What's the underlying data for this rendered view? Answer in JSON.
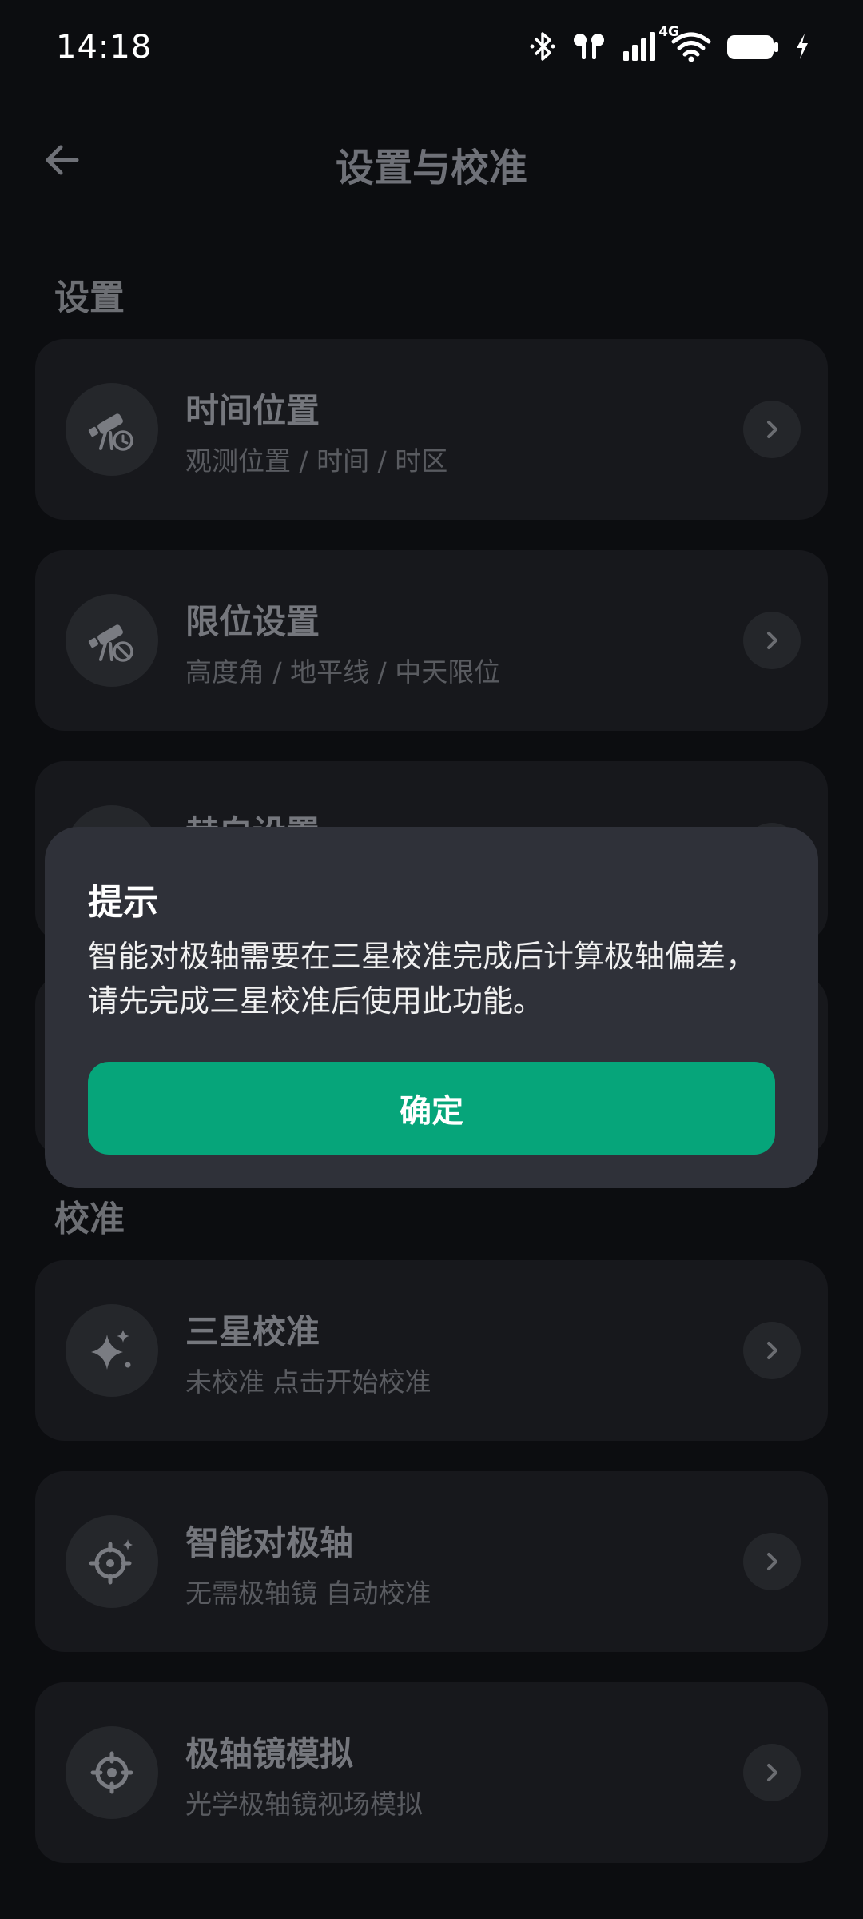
{
  "status_bar": {
    "time": "14:18",
    "network": "4G",
    "icons": [
      "bluetooth-icon",
      "earbuds-icon",
      "signal-icon",
      "wifi-icon",
      "battery-icon",
      "charging-icon"
    ]
  },
  "header": {
    "back_icon": "arrow-left-icon",
    "title": "设置与校准"
  },
  "sections": {
    "settings": "设置",
    "calibration": "校准"
  },
  "settings_items": [
    {
      "title": "时间位置",
      "subtitle": "观测位置 / 时间 / 时区",
      "icon": "telescope-clock-icon"
    },
    {
      "title": "限位设置",
      "subtitle": "高度角 / 地平线 / 中天限位",
      "icon": "telescope-block-icon"
    },
    {
      "title": "赫白设置",
      "subtitle": "",
      "icon": "telescope-icon"
    }
  ],
  "calibration_items": [
    {
      "title": "三星校准",
      "subtitle": "未校准 点击开始校准",
      "icon": "sparkle-stars-icon"
    },
    {
      "title": "智能对极轴",
      "subtitle": "无需极轴镜 自动校准",
      "icon": "target-sparkle-icon"
    },
    {
      "title": "极轴镜模拟",
      "subtitle": "光学极轴镜视场模拟",
      "icon": "crosshair-icon"
    }
  ],
  "dialog": {
    "title": "提示",
    "message": "智能对极轴需要在三星校准完成后计算极轴偏差，请先完成三星校准后使用此功能。",
    "confirm_label": "确定"
  },
  "colors": {
    "background": "#0c0d10",
    "card": "#17181c",
    "dialog": "#2f3139",
    "accent": "#06a57a"
  }
}
